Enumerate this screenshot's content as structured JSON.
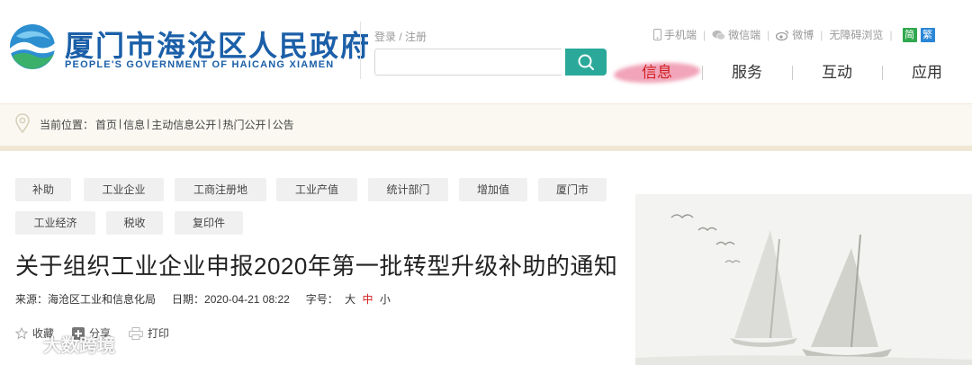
{
  "header": {
    "site_title": "厦门市海沧区人民政府",
    "site_subtitle": "PEOPLE'S GOVERNMENT OF HAICANG XIAMEN",
    "login_label": "登录 / 注册",
    "search": {
      "value": "",
      "placeholder": ""
    },
    "toplinks": [
      {
        "icon": "mobile-icon",
        "label": "手机端"
      },
      {
        "icon": "wechat-icon",
        "label": "微信端"
      },
      {
        "icon": "weibo-icon",
        "label": "微博"
      },
      {
        "label": "无障碍浏览"
      }
    ],
    "lang_simplified": "简",
    "lang_traditional": "繁",
    "nav": [
      "信息",
      "服务",
      "互动",
      "应用"
    ]
  },
  "breadcrumb": {
    "prefix": "当前位置：",
    "items": [
      "首页",
      "信息",
      "主动信息公开",
      "热门公开",
      "公告"
    ],
    "sep": " | "
  },
  "tags": [
    "补助",
    "工业企业",
    "工商注册地",
    "工业产值",
    "统计部门",
    "增加值",
    "厦门市",
    "工业经济",
    "税收",
    "复印件"
  ],
  "article": {
    "title": "关于组织工业企业申报2020年第一批转型升级补助的通知",
    "source_label": "来源：",
    "source": "海沧区工业和信息化局",
    "date_label": "日期：",
    "date": "2020-04-21 08:22",
    "font_label": "字号：",
    "font_large": "大",
    "font_medium": "中",
    "font_small": "小"
  },
  "actions": {
    "favorite": "收藏",
    "share": "分享",
    "print": "打印"
  },
  "watermark": "大数跨境",
  "colors": {
    "brand_blue": "#1b5fa8",
    "search_green": "#2aa99a",
    "active_red": "#d11f1f",
    "lang_green": "#2fa84f",
    "lang_blue": "#2a86d6"
  }
}
